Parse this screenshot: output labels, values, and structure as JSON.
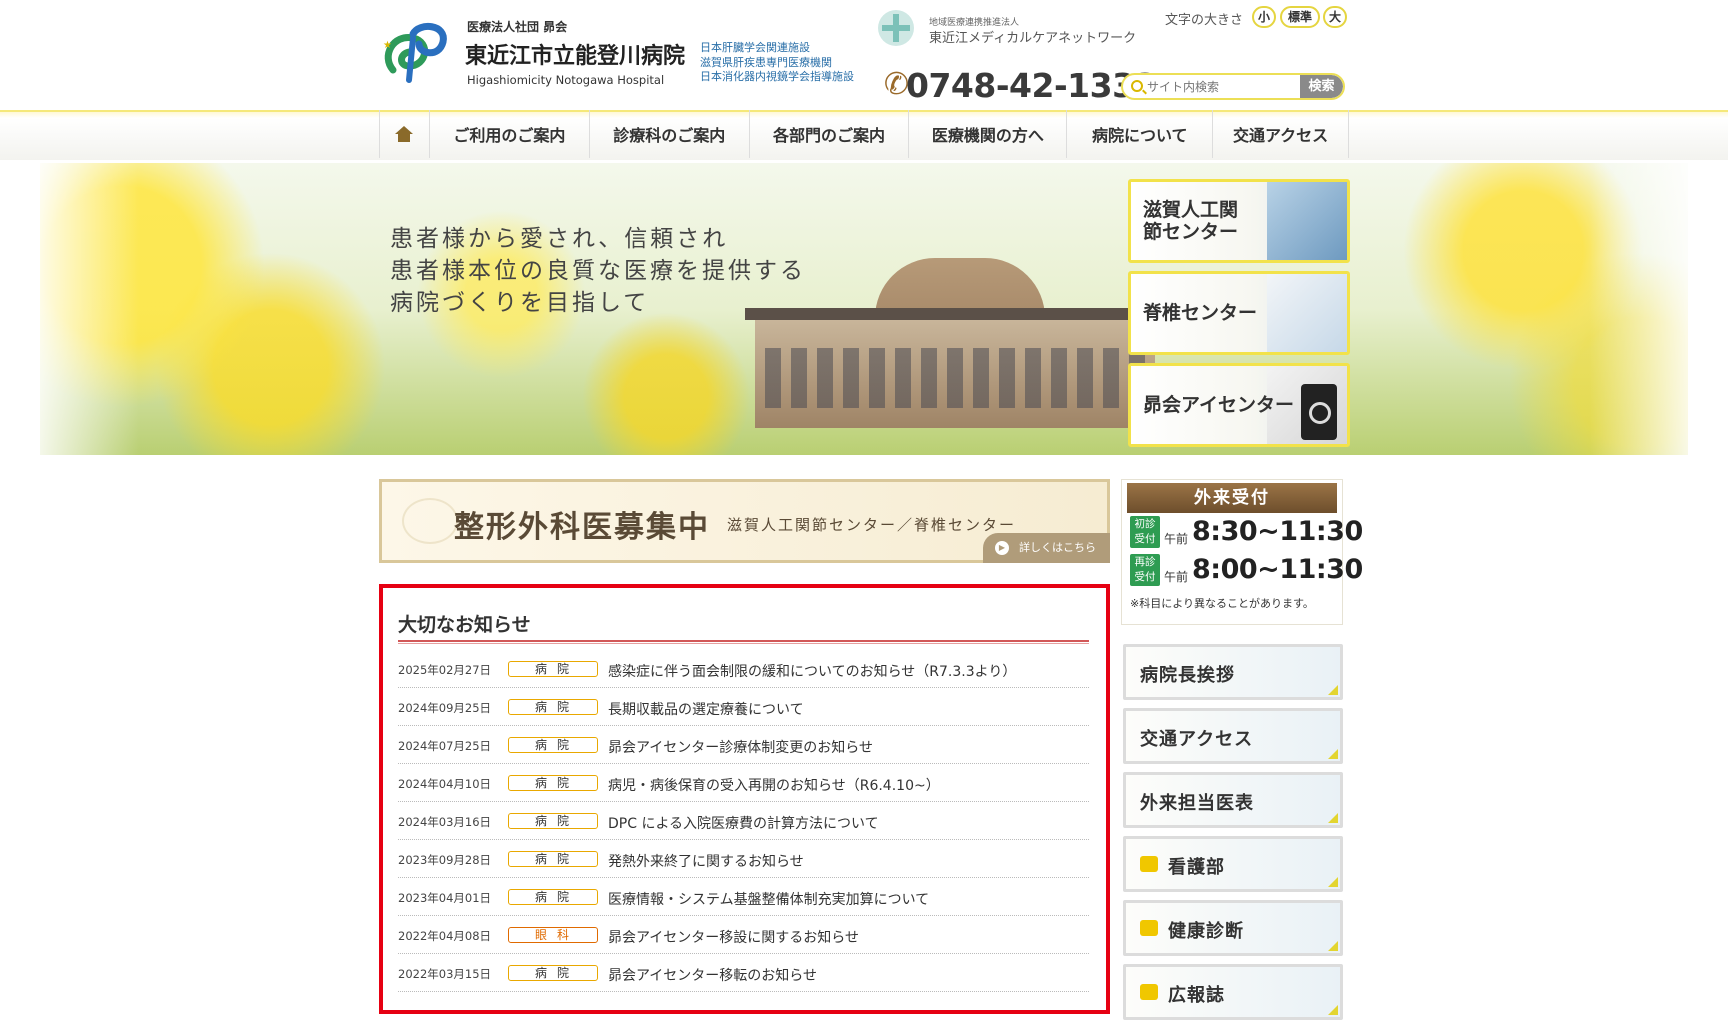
{
  "header": {
    "corp": "医療法人社団 昴会",
    "hospital_name": "東近江市立能登川病院",
    "hospital_en": "Higashiomicity Notogawa Hospital",
    "affiliations": [
      "日本肝臓学会関連施設",
      "滋賀県肝疾患専門医療機関",
      "日本消化器内視鏡学会指導施設"
    ],
    "network_sub": "地域医療連携推進法人",
    "network_name": "東近江メディカルケアネットワーク",
    "phone": "0748-42-1333",
    "font_size_label": "文字の大きさ",
    "font_size_small": "小",
    "font_size_standard": "標準",
    "font_size_large": "大",
    "search_placeholder": "サイト内検索",
    "search_button": "検索"
  },
  "nav": {
    "items": [
      "ご利用のご案内",
      "診療科のご案内",
      "各部門のご案内",
      "医療機関の方へ",
      "病院について",
      "交通アクセス"
    ]
  },
  "hero": {
    "lines": [
      "患者様から愛され、信頼され",
      "患者様本位の良質な医療を提供する",
      "病院づくりを目指して"
    ],
    "banners": [
      "滋賀人工関節センター",
      "脊椎センター",
      "昴会アイセンター"
    ]
  },
  "recruit": {
    "title": "整形外科医募集中",
    "subtitle": "滋賀人工関節センター／脊椎センター",
    "more": "詳しくはこちら"
  },
  "reception": {
    "title": "外来受付",
    "rows": [
      {
        "tag": "初診受付",
        "prefix": "午前",
        "time": "8:30~11:30"
      },
      {
        "tag": "再診受付",
        "prefix": "午前",
        "time": "8:00~11:30"
      }
    ],
    "note": "※科目により異なることがあります。"
  },
  "side_buttons": [
    "病院長挨拶",
    "交通アクセス",
    "外来担当医表",
    "看護部",
    "健康診断",
    "広報誌"
  ],
  "notice": {
    "title": "大切なお知らせ",
    "items": [
      {
        "date": "2025年02月27日",
        "category": "病院",
        "title": "感染症に伴う面会制限の緩和についてのお知らせ（R7.3.3より）"
      },
      {
        "date": "2024年09月25日",
        "category": "病院",
        "title": "長期収載品の選定療養について"
      },
      {
        "date": "2024年07月25日",
        "category": "病院",
        "title": "昴会アイセンター診療体制変更のお知らせ"
      },
      {
        "date": "2024年04月10日",
        "category": "病院",
        "title": "病児・病後保育の受入再開のお知らせ（R6.4.10~）"
      },
      {
        "date": "2024年03月16日",
        "category": "病院",
        "title": "DPC による入院医療費の計算方法について"
      },
      {
        "date": "2023年09月28日",
        "category": "病院",
        "title": "発熱外来終了に関するお知らせ"
      },
      {
        "date": "2023年04月01日",
        "category": "病院",
        "title": "医療情報・システム基盤整備体制充実加算について"
      },
      {
        "date": "2022年04月08日",
        "category": "眼科",
        "title": "昴会アイセンター移設に関するお知らせ"
      },
      {
        "date": "2022年03月15日",
        "category": "病院",
        "title": "昴会アイセンター移転のお知らせ"
      }
    ]
  },
  "colors": {
    "accent_yellow": "#f2e24a",
    "notice_border": "#e60012",
    "reception_green": "#2e9c52",
    "brown": "#8a6a2a"
  }
}
